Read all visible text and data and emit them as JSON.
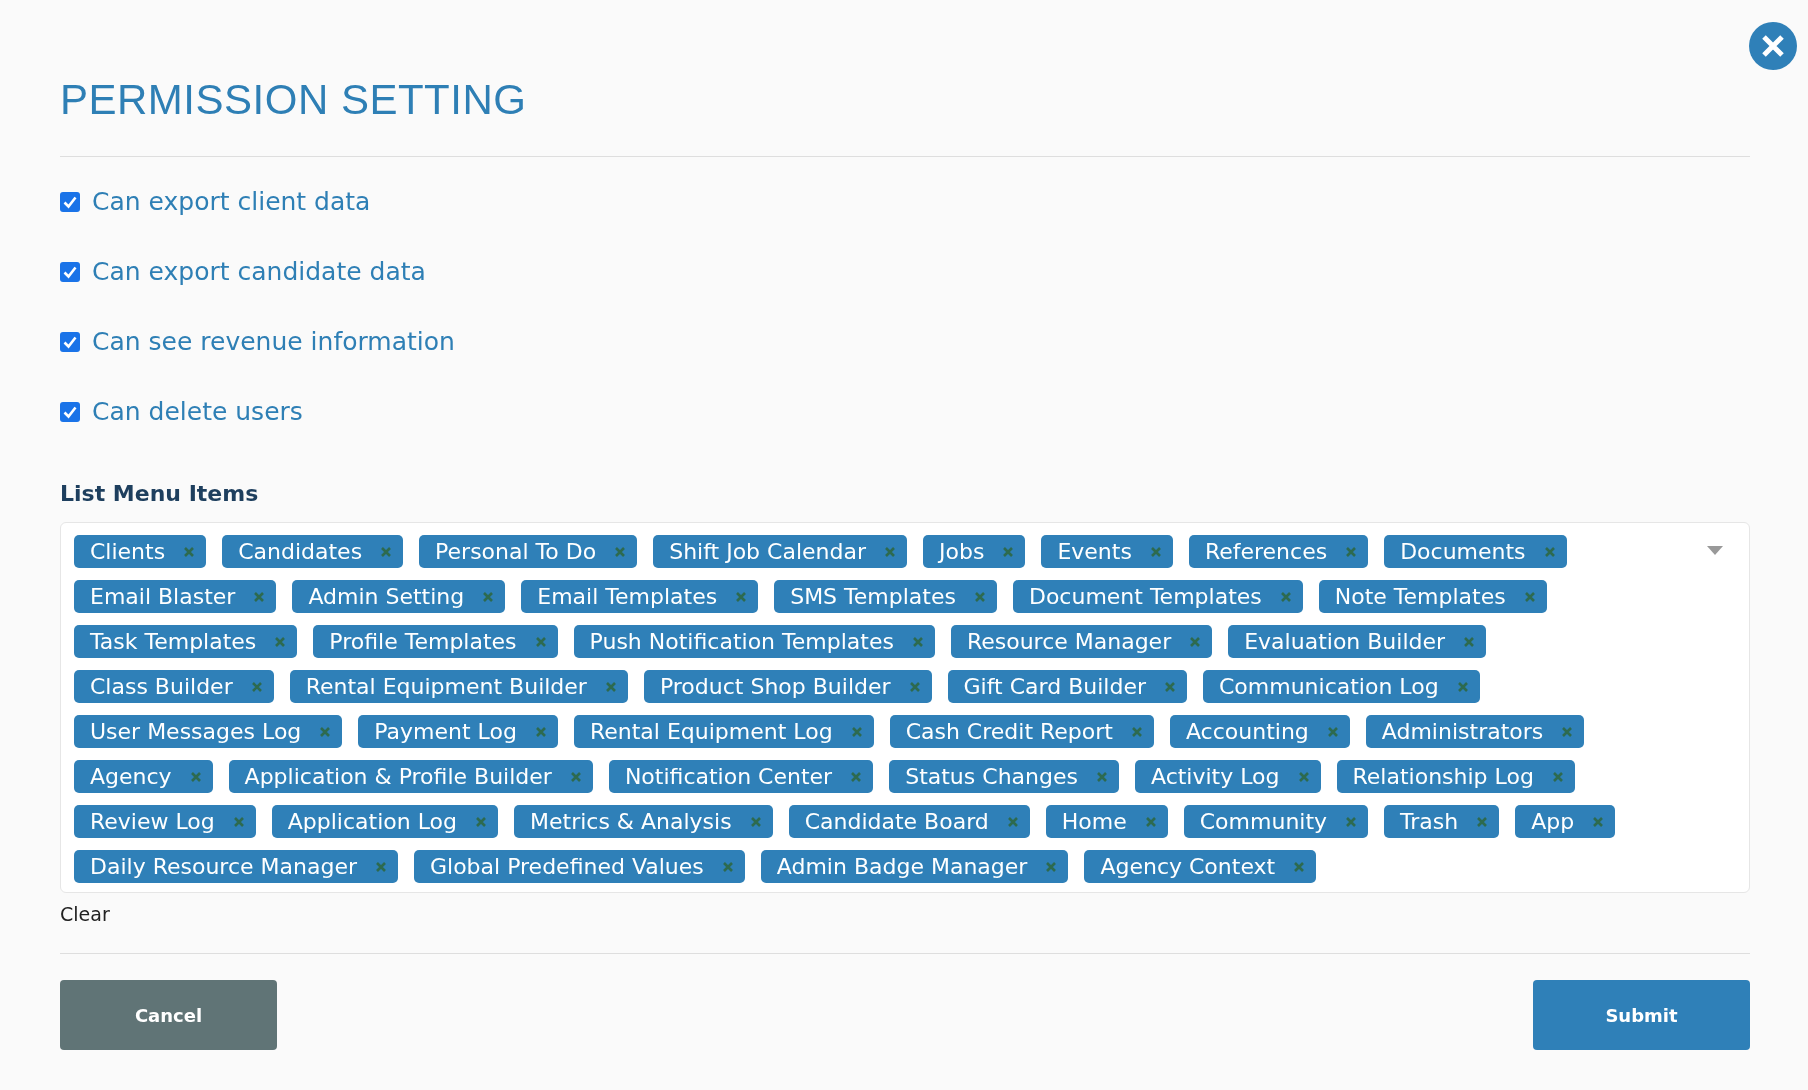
{
  "title": "PERMISSION SETTING",
  "permissions": [
    {
      "label": "Can export client data",
      "checked": true
    },
    {
      "label": "Can export candidate data",
      "checked": true
    },
    {
      "label": "Can see revenue information",
      "checked": true
    },
    {
      "label": "Can delete users",
      "checked": true
    }
  ],
  "menu_items": {
    "label": "List Menu Items",
    "tags": [
      "Clients",
      "Candidates",
      "Personal To Do",
      "Shift Job Calendar",
      "Jobs",
      "Events",
      "References",
      "Documents",
      "Email Blaster",
      "Admin Setting",
      "Email Templates",
      "SMS Templates",
      "Document Templates",
      "Note Templates",
      "Task Templates",
      "Profile Templates",
      "Push Notification Templates",
      "Resource Manager",
      "Evaluation Builder",
      "Class Builder",
      "Rental Equipment Builder",
      "Product Shop Builder",
      "Gift Card Builder",
      "Communication Log",
      "User Messages Log",
      "Payment Log",
      "Rental Equipment Log",
      "Cash Credit Report",
      "Accounting",
      "Administrators",
      "Agency",
      "Application & Profile Builder",
      "Notification Center",
      "Status Changes",
      "Activity Log",
      "Relationship Log",
      "Review Log",
      "Application Log",
      "Metrics & Analysis",
      "Candidate Board",
      "Home",
      "Community",
      "Trash",
      "App",
      "Daily Resource Manager",
      "Global Predefined Values",
      "Admin Badge Manager",
      "Agency Context"
    ],
    "clear": "Clear"
  },
  "buttons": [
    {
      "label": "Cancel",
      "kind": "secondary"
    },
    {
      "label": "Submit",
      "kind": "primary"
    }
  ]
}
